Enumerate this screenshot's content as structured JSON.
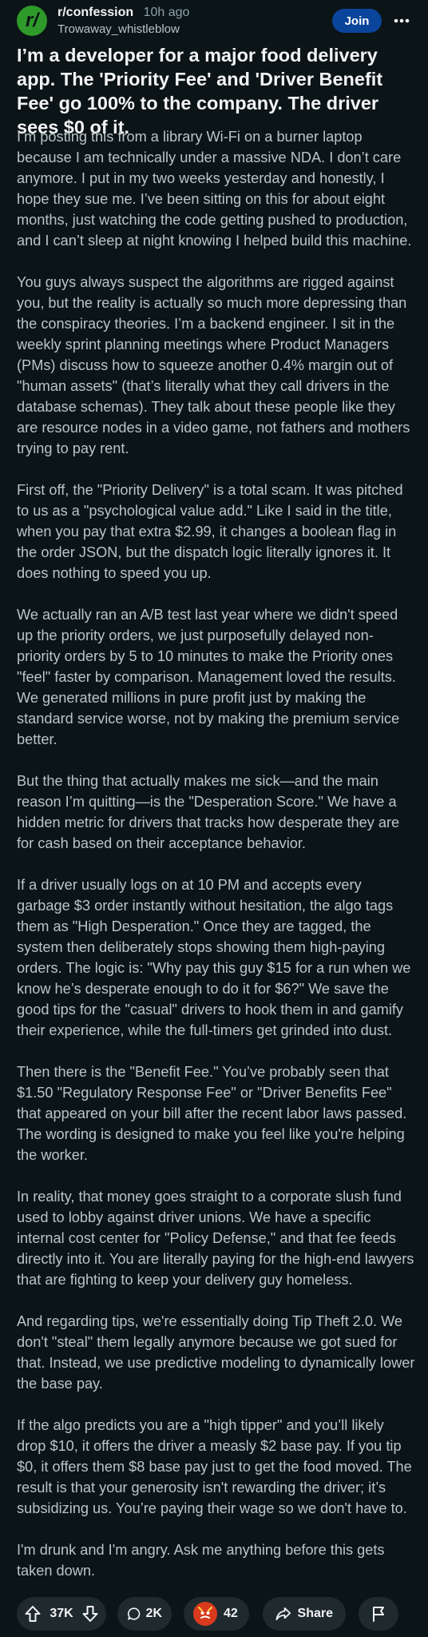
{
  "header": {
    "avatar_letter": "r/",
    "subreddit": "r/confession",
    "age": "10h ago",
    "author": "Trowaway_whistleblow",
    "join_label": "Join"
  },
  "post": {
    "title": "I’m a developer for a major food delivery app. The 'Priority Fee' and 'Driver Benefit Fee' go 100% to the company. The driver sees $0 of it.",
    "paragraphs": [
      "I’m posting this from a library Wi-Fi on a burner laptop because I am technically under a massive NDA. I don’t care anymore. I put in my two weeks yesterday and honestly, I hope they sue me. I’ve been sitting on this for about eight months, just watching the code getting pushed to production, and I can’t sleep at night knowing I helped build this machine.",
      "You guys always suspect the algorithms are rigged against you, but the reality is actually so much more depressing than the conspiracy theories. I’m a backend engineer. I sit in the weekly sprint planning meetings where Product Managers (PMs) discuss how to squeeze another 0.4% margin out of \"human assets\" (that’s literally what they call drivers in the database schemas). They talk about these people like they are resource nodes in a video game, not fathers and mothers trying to pay rent.",
      "First off, the \"Priority Delivery\" is a total scam. It was pitched to us as a \"psychological value add.\" Like I said in the title, when you pay that extra $2.99, it changes a boolean flag in the order JSON, but the dispatch logic literally ignores it. It does nothing to speed you up.",
      "We actually ran an A/B test last year where we didn't speed up the priority orders, we just purposefully delayed non-priority orders by 5 to 10 minutes to make the Priority ones \"feel\" faster by comparison. Management loved the results. We generated millions in pure profit just by making the standard service worse, not by making the premium service better.",
      "But the thing that actually makes me sick—and the main reason I’m quitting—is the \"Desperation Score.\" We have a hidden metric for drivers that tracks how desperate they are for cash based on their acceptance behavior.",
      "If a driver usually logs on at 10 PM and accepts every garbage $3 order instantly without hesitation, the algo tags them as \"High Desperation.\" Once they are tagged, the system then deliberately stops showing them high-paying orders. The logic is: \"Why pay this guy $15 for a run when we know he’s desperate enough to do it for $6?\" We save the good tips for the \"casual\" drivers to hook them in and gamify their experience, while the full-timers get grinded into dust.",
      "Then there is the \"Benefit Fee.\" You’ve probably seen that $1.50 \"Regulatory Response Fee\" or \"Driver Benefits Fee\" that appeared on your bill after the recent labor laws passed. The wording is designed to make you feel like you're helping the worker.",
      "In reality, that money goes straight to a corporate slush fund used to lobby against driver unions. We have a specific internal cost center for \"Policy Defense,\" and that fee feeds directly into it. You are literally paying for the high-end lawyers that are fighting to keep your delivery guy homeless.",
      "And regarding tips, we're essentially doing Tip Theft 2.0. We don't \"steal\" them legally anymore because we got sued for that. Instead, we use predictive modeling to dynamically lower the base pay.",
      "If the algo predicts you are a \"high tipper\" and you’ll likely drop $10, it offers the driver a measly $2 base pay. If you tip $0, it offers them $8 base pay just to get the food moved. The result is that your generosity isn't rewarding the driver; it’s subsidizing us. You’re paying their wage so we don't have to.",
      "I'm drunk and I'm angry. Ask me anything before this gets taken down."
    ]
  },
  "actions": {
    "upvotes": "37K",
    "comments": "2K",
    "awards": "42",
    "share_label": "Share"
  },
  "icons": {
    "more": "more-dots-icon",
    "upvote": "upvote-arrow-icon",
    "downvote": "downvote-arrow-icon",
    "comment": "comment-bubble-icon",
    "award": "award-face-icon",
    "share": "share-arrow-icon",
    "report": "flag-icon"
  },
  "colors": {
    "background": "#0b1416",
    "join": "#0a449b",
    "avatar": "#2e9a2a",
    "pill": "#1f2a2e",
    "award": "#d93a1e"
  }
}
